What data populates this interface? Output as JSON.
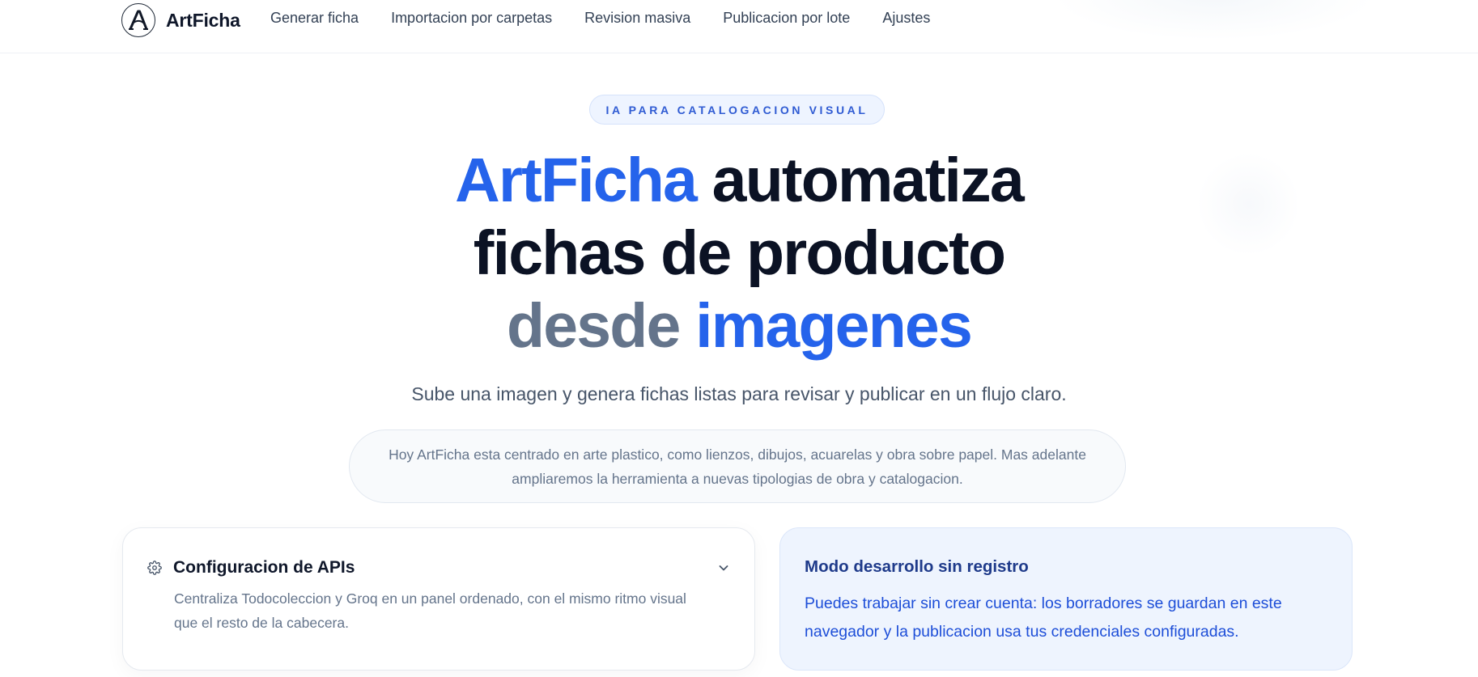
{
  "brand": {
    "name": "ArtFicha",
    "logo_letter": "A"
  },
  "nav": {
    "items": [
      {
        "label": "Generar ficha"
      },
      {
        "label": "Importacion por carpetas"
      },
      {
        "label": "Revision masiva"
      },
      {
        "label": "Publicacion por lote"
      },
      {
        "label": "Ajustes"
      }
    ]
  },
  "hero": {
    "pill": "IA PARA CATALOGACION VISUAL",
    "headline": {
      "part1_accent": "ArtFicha",
      "part1_rest": " automatiza",
      "line2": "fichas de producto",
      "line3_muted": "desde",
      "line3_accent": "imagenes"
    },
    "subtitle": "Sube una imagen y genera fichas listas para revisar y publicar en un flujo claro.",
    "note": "Hoy ArtFicha esta centrado en arte plastico, como lienzos, dibujos, acuarelas y obra sobre papel. Mas adelante ampliaremos la herramienta a nuevas tipologias de obra y catalogacion."
  },
  "api_card": {
    "title": "Configuracion de APIs",
    "description": "Centraliza Todocoleccion y Groq en un panel ordenado, con el mismo ritmo visual que el resto de la cabecera.",
    "icon": "gear-icon",
    "toggle_icon": "chevron-down-icon"
  },
  "dev_card": {
    "title": "Modo desarrollo sin registro",
    "description": "Puedes trabajar sin crear cuenta: los borradores se guardan en este navegador y la publicacion usa tus credenciales configuradas."
  },
  "colors": {
    "accent": "#2563eb",
    "heading": "#0b1224",
    "muted": "#64748b",
    "pill_bg": "#eef4ff",
    "dev_card_bg": "#eef4fe"
  }
}
